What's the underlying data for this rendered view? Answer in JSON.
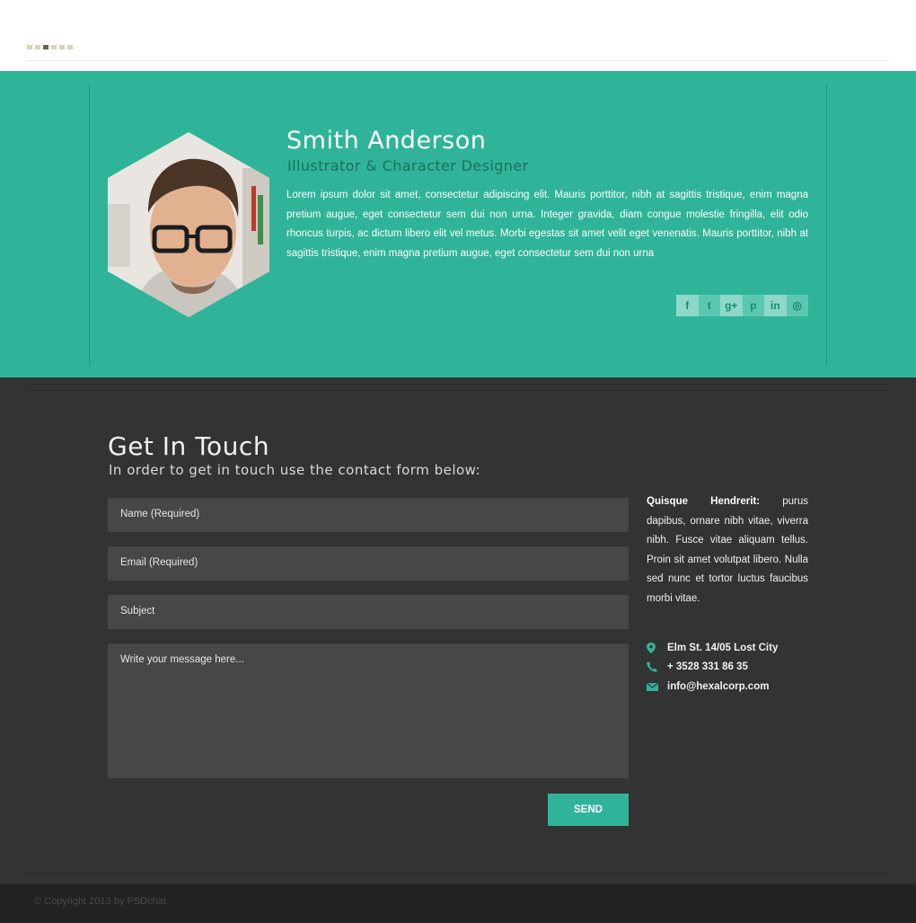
{
  "header": {
    "pager_dots": 6,
    "pager_active_index": 2
  },
  "profile": {
    "name": "Smith Anderson",
    "role": "Illustrator & Character Designer",
    "bio": "Lorem ipsum dolor sit amet, consectetur adipiscing elit. Mauris porttitor, nibh at sagittis tristique, enim magna pretium augue, eget consectetur sem dui non urna. Integer gravida, diam congue molestie fringilla, elit odio rhoncus turpis, ac dictum libero elit vel metus. Morbi egestas sit amet velit eget venenatis. Mauris porttitor, nibh at sagittis tristique, enim magna pretium augue, eget consectetur sem dui non urna",
    "social": [
      {
        "icon": "facebook-icon",
        "glyph": "f"
      },
      {
        "icon": "twitter-icon",
        "glyph": "t"
      },
      {
        "icon": "google-plus-icon",
        "glyph": "g+"
      },
      {
        "icon": "pinterest-icon",
        "glyph": "p"
      },
      {
        "icon": "linkedin-icon",
        "glyph": "in"
      },
      {
        "icon": "dribbble-icon",
        "glyph": "◎"
      }
    ]
  },
  "contact": {
    "title": "Get In Touch",
    "subtitle": "In order to get in touch use the contact form below:",
    "fields": {
      "name_placeholder": "Name (Required)",
      "email_placeholder": "Email (Required)",
      "subject_placeholder": "Subject",
      "message_placeholder": "Write your message here..."
    },
    "send_label": "SEND",
    "aside_bold": "Quisque Hendrerit:",
    "aside_text": " purus dapibus, ornare nibh vitae, viverra nibh. Fusce vitae aliquam tellus. Proin sit amet volutpat libero. Nulla sed nunc et tortor luctus faucibus morbi vitae.",
    "address": "Elm St. 14/05 Lost City",
    "phone": "+ 3528 331 86 35",
    "email": "info@hexalcorp.com"
  },
  "footer": {
    "copyright": "© Copyright 2013 by PSDchat"
  },
  "colors": {
    "accent": "#2fb499",
    "dark_bg": "#333333",
    "footer_bg": "#222222",
    "field_bg": "#474747"
  }
}
